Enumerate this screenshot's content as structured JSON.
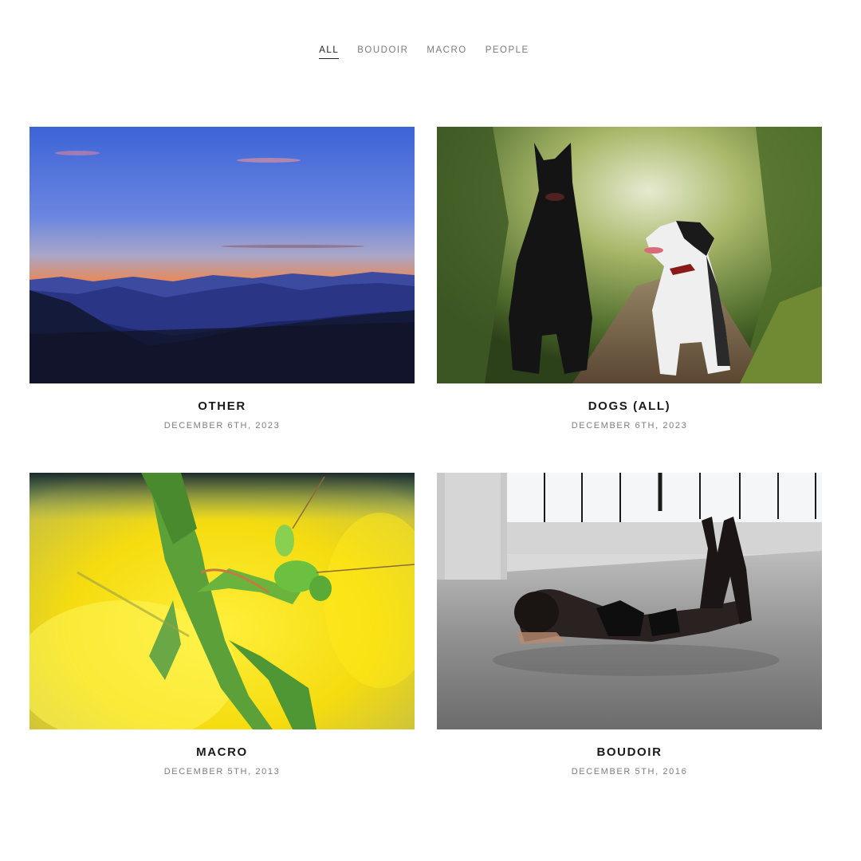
{
  "filters": [
    {
      "label": "ALL",
      "active": true
    },
    {
      "label": "BOUDOIR",
      "active": false
    },
    {
      "label": "MACRO",
      "active": false
    },
    {
      "label": "PEOPLE",
      "active": false
    }
  ],
  "gallery": [
    {
      "title": "OTHER",
      "date": "DECEMBER 6TH, 2023",
      "image": "sunset-mountains-photo"
    },
    {
      "title": "DOGS (ALL)",
      "date": "DECEMBER 6TH, 2023",
      "image": "two-dogs-photo"
    },
    {
      "title": "MACRO",
      "date": "DECEMBER 5TH, 2013",
      "image": "praying-mantis-photo"
    },
    {
      "title": "BOUDOIR",
      "date": "DECEMBER 5TH, 2016",
      "image": "woman-on-floor-photo"
    }
  ]
}
